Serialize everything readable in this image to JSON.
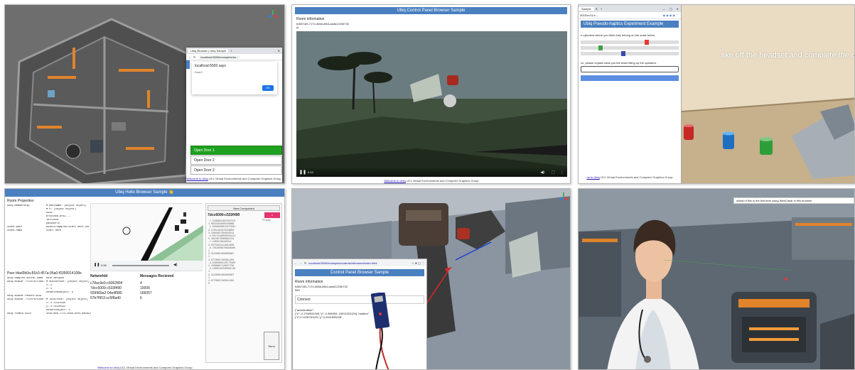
{
  "panel1": {
    "popup_tab": "Ubiq Browser | Ubiq Sample",
    "popup_url": "localhost:5500/examples/sa...",
    "popup_msg_title": "localhost:5500 says",
    "popup_msg_body": "Door2",
    "popup_ok": "OK",
    "doors": [
      "Open Door 1",
      "Open Door 2",
      "Open Door 3"
    ],
    "footer_link": "Welcome to Ubiq",
    "footer_text": " UCL Virtual Environments and Computer Graphics Group."
  },
  "panel2": {
    "header": "Ubiq Control Panel Browser Sample",
    "room_label": "Room information",
    "room_id": "fc587165-7174-466b-8fe4-aa4d1223b732",
    "room_code": "j4",
    "time": "0:13",
    "footer_link": "Welcome to Ubiq",
    "footer_text": " UCL Virtual Environments and Computer Graphics Group."
  },
  "panel3": {
    "tab": "Sample",
    "url": "3015/rc/11/c...",
    "header": "Ubiq Pseudo-haptics Experiment Example",
    "instruction": "e cylinders where you think they belong on the scale below",
    "question": "ce, please explain what you felt when lifting up the cylinders.",
    "vr_prompt_plain": "ake off the headset and complete ",
    "vr_prompt_italic": "the questionnaire",
    "footer_link": "ne to Ubiq",
    "footer_text": " UCL Virtual Environments and Computer Graphics Group.",
    "slider_colors": [
      "#e53935",
      "#43a047",
      "#3949ab"
    ],
    "cylinder_colors": [
      "#c62828",
      "#1e6fc0",
      "#2e9e3a"
    ]
  },
  "panel4": {
    "header": "Ubiq Hello Browser Sample",
    "room_props_title": "Room Properties",
    "room_props": [
      {
        "key": "ubiq.membership",
        "value": "▼ peerName: [object Object]"
      },
      {
        "key": "",
        "value": "▼ 0: [object Object]"
      },
      {
        "key": "",
        "value": "uuid:"
      },
      {
        "key": "",
        "value": "bfcd3d0a-8fb3-..."
      },
      {
        "key": "",
        "value": "1b2f2ebd"
      },
      {
        "key": "",
        "value": "passworld"
      },
      {
        "key": "scene.path",
        "value": "Assets/Samples/Start Here.unity"
      },
      {
        "key": "scene.name",
        "value": "Start Here"
      }
    ],
    "peer_title": "Peer bfad3b0a-81b3-457a-95a0-f0390014108e",
    "peer_props": [
      {
        "key": "ubiq.samples.social.name",
        "value": "Ruth Bergsun"
      },
      {
        "key": "ubiq.avatar.??t2h?a?t2ea?",
        "value": "▼ avatarPose: [object Object]"
      },
      {
        "key": "",
        "value": "x: 0"
      },
      {
        "key": "",
        "value": "z: 0"
      },
      {
        "key": "",
        "value": "networkedObject: 0"
      },
      {
        "key": "ubiq.avatar.remote.uuid",
        "value": ""
      },
      {
        "key": "ubiq.avatar.??t2h?a?t2ea?",
        "value": "▼ localPose: [object Object]"
      },
      {
        "key": "",
        "value": "x: 0.12313440"
      },
      {
        "key": "",
        "value": "y: 0.35345432"
      },
      {
        "key": "",
        "value": "networkObject: 0"
      },
      {
        "key": "ubiq.roomio.uuid",
        "value": "4c56?a6b-7174-466b-8fe4-aa4d1223b732"
      }
    ],
    "time": "0:06",
    "table_head": [
      "NetworkId",
      "Messages Recieved"
    ],
    "table_rows": [
      [
        "c78ac9e0-c6062804",
        "4"
      ],
      [
        "7dcc6000-c533f490",
        "10006"
      ],
      [
        "939969a2-04e4f985",
        "168357"
      ],
      [
        "67b7f653-cc5f8ad0",
        "6"
      ]
    ],
    "side_header": "New Component",
    "side_id": "7dcc6000-c533f490",
    "side_x": "x",
    "side_float": "float",
    "side_numbers": [
      "-7.15693631607827213",
      "1.06224303605109868",
      "-1.04049996543273332",
      "2.17051161679158994",
      "3.22619027958935214",
      "-0.56772166509554212",
      "5.48129570668891154",
      "-7.16652136185514",
      "3.50753531413813926",
      "-6.78516086766946206",
      "1",
      "2.21105001858665887",
      "1",
      "2.07705037465811282",
      "-4.54850885125774400",
      "1.22666897128557756",
      "-3.16605261590041748",
      "1",
      "2.21105001858665887",
      "1",
      "2.07705037465811282",
      "0"
    ],
    "send_label": "Send",
    "footer_link": "Welcome to Ubiq",
    "footer_text": " UCL Virtual Environments and Computer Graphics Group."
  },
  "panel5": {
    "url": "localhost:5500/examples/controls/ebrowser/index.html",
    "header": "Control Panel Browser Sample",
    "room_label": "Room information",
    "room_id": "fc587165-7174-466b-8fe4-aa4d1223b732",
    "room_code": "559",
    "connect_label": "Connect",
    "accel_line1": "{\"acceleration\":",
    "accel_line2": "{\"x\":-0.1758931925,\"y\":-0.398393..15911320125},\"rotation\"",
    "accel_line3": "{\"x\":0.1226761125,\"y\":0.2441695228..."
  },
  "panel6": {
    "banner": "ulliodo if this is the first time using WebCasar in this browser"
  }
}
